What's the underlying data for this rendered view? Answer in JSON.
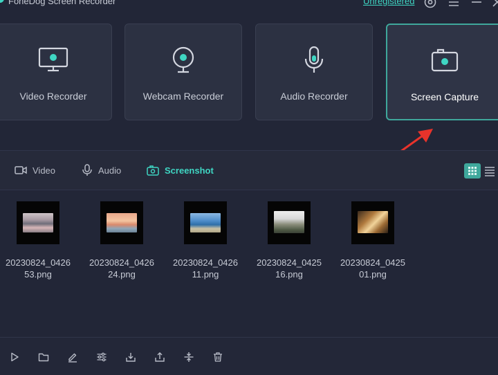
{
  "window": {
    "title": "FoneDog Screen Recorder",
    "unregistered_label": "Unregistered",
    "icons": [
      "settings-icon",
      "menu-icon",
      "minimize-icon",
      "close-icon"
    ]
  },
  "recorder_cards": [
    {
      "label": "Video Recorder",
      "icon": "monitor-icon",
      "active": false
    },
    {
      "label": "Webcam Recorder",
      "icon": "webcam-icon",
      "active": false
    },
    {
      "label": "Audio Recorder",
      "icon": "microphone-icon",
      "active": false
    },
    {
      "label": "Screen Capture",
      "icon": "camera-icon",
      "active": true
    }
  ],
  "tabs": [
    {
      "label": "Video",
      "icon": "video-camera-icon",
      "active": false
    },
    {
      "label": "Audio",
      "icon": "microphone-icon",
      "active": false
    },
    {
      "label": "Screenshot",
      "icon": "camera-icon",
      "active": true
    }
  ],
  "view_mode": "grid",
  "files": [
    {
      "name_line1": "20230824_0426",
      "name_line2": "53.png"
    },
    {
      "name_line1": "20230824_0426",
      "name_line2": "24.png"
    },
    {
      "name_line1": "20230824_0426",
      "name_line2": "11.png"
    },
    {
      "name_line1": "20230824_0425",
      "name_line2": "16.png"
    },
    {
      "name_line1": "20230824_0425",
      "name_line2": "01.png"
    }
  ],
  "toolbar_icons": [
    "play-icon",
    "folder-icon",
    "edit-icon",
    "adjust-icon",
    "import-icon",
    "share-icon",
    "merge-icon",
    "trash-icon"
  ],
  "colors": {
    "background": "#222637",
    "accent": "#3fd6c3",
    "card": "#2c3142",
    "annotation_arrow": "#e8332b"
  }
}
